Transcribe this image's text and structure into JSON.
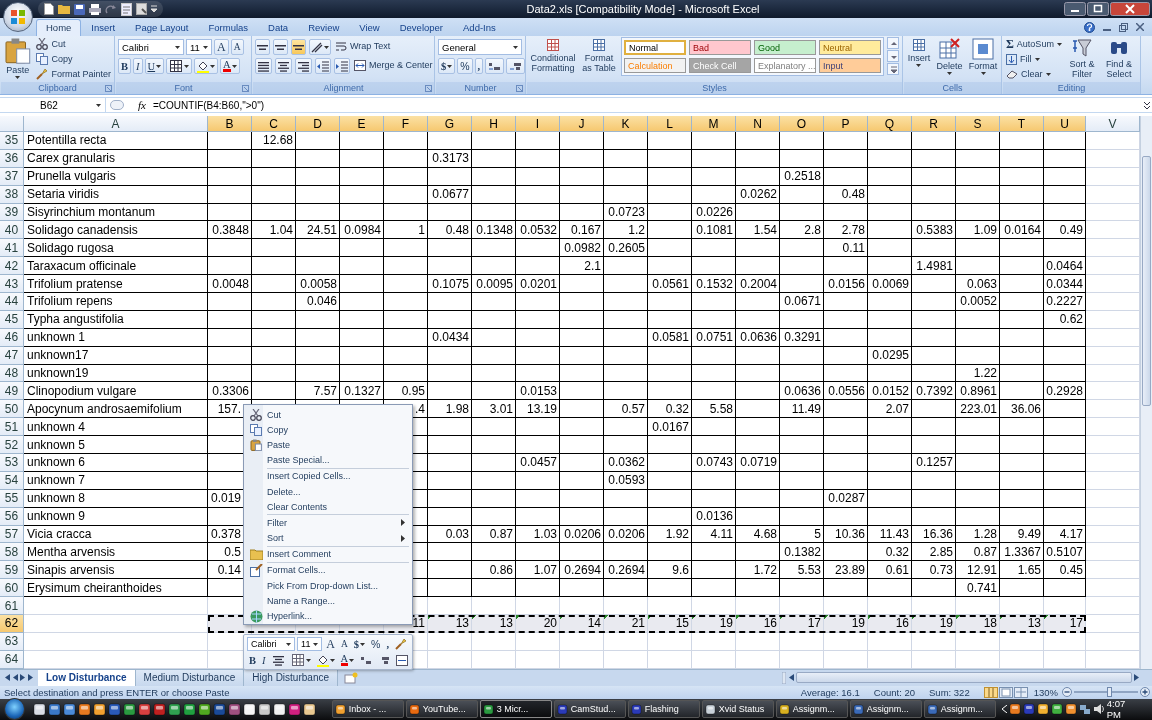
{
  "window": {
    "title": "Data2.xls  [Compatibility Mode] - Microsoft Excel"
  },
  "ribbon_tabs": [
    {
      "label": "Home",
      "selected": true
    },
    {
      "label": "Insert",
      "selected": false
    },
    {
      "label": "Page Layout",
      "selected": false
    },
    {
      "label": "Formulas",
      "selected": false
    },
    {
      "label": "Data",
      "selected": false
    },
    {
      "label": "Review",
      "selected": false
    },
    {
      "label": "View",
      "selected": false
    },
    {
      "label": "Developer",
      "selected": false
    },
    {
      "label": "Add-Ins",
      "selected": false
    }
  ],
  "ribbon": {
    "clipboard": {
      "label": "Clipboard",
      "paste": "Paste",
      "items": [
        "Cut",
        "Copy",
        "Format Painter"
      ]
    },
    "font": {
      "label": "Font",
      "name": "Calibri",
      "size": "11",
      "grow": "A",
      "shrink": "A",
      "bold": "B",
      "italic": "I",
      "underline": "U",
      "color_letter": "A"
    },
    "alignment": {
      "label": "Alignment",
      "wrap": "Wrap Text",
      "merge": "Merge & Center"
    },
    "number": {
      "label": "Number",
      "format": "General",
      "currency": "$",
      "percent": "%",
      "comma": ","
    },
    "styles": {
      "label": "Styles",
      "conditional": "Conditional Formatting",
      "table": "Format as Table",
      "gallery": [
        {
          "label": "Normal",
          "color": "#ffffff",
          "selected": true
        },
        {
          "label": "Bad",
          "color": "#ffc7ce",
          "selected": false
        },
        {
          "label": "Good",
          "color": "#c6efce",
          "selected": false
        },
        {
          "label": "Neutral",
          "color": "#ffeb9c",
          "selected": false
        },
        {
          "label": "Calculation",
          "color": "#f2f2f2",
          "selected": false
        },
        {
          "label": "Check Cell",
          "color": "#a5a5a5",
          "selected": false
        },
        {
          "label": "Explanatory ...",
          "color": "#ffffff",
          "selected": false
        },
        {
          "label": "Input",
          "color": "#ffcc99",
          "selected": false
        }
      ]
    },
    "cells": {
      "label": "Cells",
      "buttons": [
        "Insert",
        "Delete",
        "Format"
      ]
    },
    "editing": {
      "label": "Editing",
      "sigma": "Σ",
      "autosum": "AutoSum",
      "fill": "Fill",
      "clear": "Clear",
      "sort": "Sort & Filter",
      "find": "Find & Select"
    }
  },
  "formula_bar": {
    "name_box": "B62",
    "fx": "fx",
    "formula": "=COUNTIF(B4:B60,\">0\")"
  },
  "columns": [
    {
      "label": "A",
      "selected": false
    },
    {
      "label": "B",
      "selected": true
    },
    {
      "label": "C",
      "selected": true
    },
    {
      "label": "D",
      "selected": true
    },
    {
      "label": "E",
      "selected": true
    },
    {
      "label": "F",
      "selected": true
    },
    {
      "label": "G",
      "selected": true
    },
    {
      "label": "H",
      "selected": true
    },
    {
      "label": "I",
      "selected": true
    },
    {
      "label": "J",
      "selected": true
    },
    {
      "label": "K",
      "selected": true
    },
    {
      "label": "L",
      "selected": true
    },
    {
      "label": "M",
      "selected": true
    },
    {
      "label": "N",
      "selected": true
    },
    {
      "label": "O",
      "selected": true
    },
    {
      "label": "P",
      "selected": true
    },
    {
      "label": "Q",
      "selected": true
    },
    {
      "label": "R",
      "selected": true
    },
    {
      "label": "S",
      "selected": true
    },
    {
      "label": "T",
      "selected": true
    },
    {
      "label": "U",
      "selected": true
    },
    {
      "label": "V",
      "selected": false
    }
  ],
  "rows": [
    {
      "header": "35",
      "selected": false,
      "bordered": true,
      "cells": [
        "Potentilla recta",
        null,
        "12.68"
      ]
    },
    {
      "header": "36",
      "selected": false,
      "bordered": true,
      "cells": [
        "Carex granularis",
        null,
        null,
        null,
        null,
        null,
        "0.3173"
      ]
    },
    {
      "header": "37",
      "selected": false,
      "bordered": true,
      "cells": [
        "Prunella vulgaris",
        null,
        null,
        null,
        null,
        null,
        null,
        null,
        null,
        null,
        null,
        null,
        null,
        null,
        "0.2518"
      ]
    },
    {
      "header": "38",
      "selected": false,
      "bordered": true,
      "cells": [
        "Setaria viridis",
        null,
        null,
        null,
        null,
        null,
        "0.0677",
        null,
        null,
        null,
        null,
        null,
        null,
        "0.0262",
        null,
        "0.48"
      ]
    },
    {
      "header": "39",
      "selected": false,
      "bordered": true,
      "cells": [
        "Sisyrinchium montanum",
        null,
        null,
        null,
        null,
        null,
        null,
        null,
        null,
        null,
        "0.0723",
        null,
        "0.0226"
      ]
    },
    {
      "header": "40",
      "selected": false,
      "bordered": true,
      "cells": [
        "Solidago canadensis",
        "0.3848",
        "1.04",
        "24.51",
        "0.0984",
        "1",
        "0.48",
        "0.1348",
        "0.0532",
        "0.167",
        "1.2",
        null,
        "0.1081",
        "1.54",
        "2.8",
        "2.78",
        null,
        "0.5383",
        "1.09",
        "0.0164",
        "0.49"
      ]
    },
    {
      "header": "41",
      "selected": false,
      "bordered": true,
      "cells": [
        "Solidago rugosa",
        null,
        null,
        null,
        null,
        null,
        null,
        null,
        null,
        "0.0982",
        "0.2605",
        null,
        null,
        null,
        null,
        "0.11"
      ]
    },
    {
      "header": "42",
      "selected": false,
      "bordered": true,
      "cells": [
        "Taraxacum officinale",
        null,
        null,
        null,
        null,
        null,
        null,
        null,
        null,
        "2.1",
        null,
        null,
        null,
        null,
        null,
        null,
        null,
        "1.4981",
        null,
        null,
        "0.0464"
      ]
    },
    {
      "header": "43",
      "selected": false,
      "bordered": true,
      "cells": [
        "Trifolium pratense",
        "0.0048",
        null,
        "0.0058",
        null,
        null,
        "0.1075",
        "0.0095",
        "0.0201",
        null,
        null,
        "0.0561",
        "0.1532",
        "0.2004",
        null,
        "0.0156",
        "0.0069",
        null,
        "0.063",
        null,
        "0.0344"
      ]
    },
    {
      "header": "44",
      "selected": false,
      "bordered": true,
      "cells": [
        "Trifolium repens",
        null,
        null,
        "0.046",
        null,
        null,
        null,
        null,
        null,
        null,
        null,
        null,
        null,
        null,
        "0.0671",
        null,
        null,
        null,
        "0.0052",
        null,
        "0.2227"
      ]
    },
    {
      "header": "45",
      "selected": false,
      "bordered": true,
      "cells": [
        "Typha angustifolia",
        null,
        null,
        null,
        null,
        null,
        null,
        null,
        null,
        null,
        null,
        null,
        null,
        null,
        null,
        null,
        null,
        null,
        null,
        null,
        "0.62"
      ]
    },
    {
      "header": "46",
      "selected": false,
      "bordered": true,
      "cells": [
        "unknown 1",
        null,
        null,
        null,
        null,
        null,
        "0.0434",
        null,
        null,
        null,
        null,
        "0.0581",
        "0.0751",
        "0.0636",
        "0.3291"
      ]
    },
    {
      "header": "47",
      "selected": false,
      "bordered": true,
      "cells": [
        "unknown17",
        null,
        null,
        null,
        null,
        null,
        null,
        null,
        null,
        null,
        null,
        null,
        null,
        null,
        null,
        null,
        "0.0295"
      ]
    },
    {
      "header": "48",
      "selected": false,
      "bordered": true,
      "cells": [
        "unknown19",
        null,
        null,
        null,
        null,
        null,
        null,
        null,
        null,
        null,
        null,
        null,
        null,
        null,
        null,
        null,
        null,
        null,
        "1.22"
      ]
    },
    {
      "header": "49",
      "selected": false,
      "bordered": true,
      "cells": [
        "Clinopodium vulgare",
        "0.3306",
        null,
        "7.57",
        "0.1327",
        "0.95",
        null,
        null,
        "0.0153",
        null,
        null,
        null,
        null,
        null,
        "0.0636",
        "0.0556",
        "0.0152",
        "0.7392",
        "0.8961",
        null,
        "0.2928"
      ]
    },
    {
      "header": "50",
      "selected": false,
      "bordered": true,
      "cells": [
        "Apocynum androsaemifolium",
        "157.",
        null,
        null,
        null,
        ".4",
        "1.98",
        "3.01",
        "13.19",
        null,
        "0.57",
        "0.32",
        "5.58",
        null,
        "11.49",
        null,
        "2.07",
        null,
        "223.01",
        "36.06"
      ]
    },
    {
      "header": "51",
      "selected": false,
      "bordered": true,
      "cells": [
        "unknown 4",
        null,
        null,
        null,
        null,
        null,
        null,
        null,
        null,
        null,
        null,
        "0.0167"
      ]
    },
    {
      "header": "52",
      "selected": false,
      "bordered": true,
      "cells": [
        "unknown 5"
      ]
    },
    {
      "header": "53",
      "selected": false,
      "bordered": true,
      "cells": [
        "unknown 6",
        null,
        null,
        null,
        null,
        null,
        null,
        null,
        "0.0457",
        null,
        "0.0362",
        null,
        "0.0743",
        "0.0719",
        null,
        null,
        null,
        "0.1257"
      ]
    },
    {
      "header": "54",
      "selected": false,
      "bordered": true,
      "cells": [
        "unknown 7",
        null,
        null,
        null,
        null,
        null,
        null,
        null,
        null,
        null,
        "0.0593"
      ]
    },
    {
      "header": "55",
      "selected": false,
      "bordered": true,
      "cells": [
        "unknown 8",
        "0.019",
        null,
        null,
        null,
        null,
        null,
        null,
        null,
        null,
        null,
        null,
        null,
        null,
        null,
        "0.0287"
      ]
    },
    {
      "header": "56",
      "selected": false,
      "bordered": true,
      "cells": [
        "unknown 9",
        null,
        null,
        null,
        null,
        null,
        null,
        null,
        null,
        null,
        null,
        null,
        "0.0136"
      ]
    },
    {
      "header": "57",
      "selected": false,
      "bordered": true,
      "cells": [
        "Vicia cracca",
        "0.378",
        null,
        null,
        null,
        null,
        "0.03",
        "0.87",
        "1.03",
        "0.0206",
        "0.0206",
        "1.92",
        "4.11",
        "4.68",
        "5",
        "10.36",
        "11.43",
        "16.36",
        "1.28",
        "9.49",
        "4.17"
      ]
    },
    {
      "header": "58",
      "selected": false,
      "bordered": true,
      "cells": [
        "Mentha arvensis",
        "0.5",
        null,
        null,
        null,
        null,
        null,
        null,
        null,
        null,
        null,
        null,
        null,
        null,
        "0.1382",
        null,
        "0.32",
        "2.85",
        "0.87",
        "1.3367",
        "0.5107"
      ]
    },
    {
      "header": "59",
      "selected": false,
      "bordered": true,
      "cells": [
        "Sinapis arvensis",
        "0.14",
        null,
        null,
        null,
        null,
        null,
        "0.86",
        "1.07",
        "0.2694",
        "0.2694",
        "9.6",
        null,
        "1.72",
        "5.53",
        "23.89",
        "0.61",
        "0.73",
        "12.91",
        "1.65",
        "0.45"
      ]
    },
    {
      "header": "60",
      "selected": false,
      "bordered": true,
      "cells": [
        "Erysimum cheiranthoides",
        null,
        null,
        null,
        null,
        null,
        null,
        null,
        null,
        null,
        null,
        null,
        null,
        null,
        null,
        null,
        null,
        null,
        "0.741"
      ]
    },
    {
      "header": "61",
      "selected": false,
      "bordered": false,
      "cells": []
    },
    {
      "header": "62",
      "selected": true,
      "bordered": false,
      "error_marks": true,
      "cells": [
        null,
        null,
        null,
        null,
        null,
        "11",
        "13",
        "13",
        "20",
        "14",
        "21",
        "15",
        "19",
        "16",
        "17",
        "19",
        "16",
        "19",
        "18",
        "13",
        "17"
      ]
    },
    {
      "header": "63",
      "selected": false,
      "bordered": false,
      "cells": []
    },
    {
      "header": "64",
      "selected": false,
      "bordered": false,
      "cells": []
    }
  ],
  "context_menu": [
    {
      "label": "Cut",
      "icon": true,
      "separator_before": false,
      "submenu": false
    },
    {
      "label": "Copy",
      "icon": true,
      "separator_before": false,
      "submenu": false
    },
    {
      "label": "Paste",
      "icon": true,
      "separator_before": false,
      "submenu": false
    },
    {
      "label": "Paste Special...",
      "icon": false,
      "separator_before": false,
      "submenu": false
    },
    {
      "label": "Insert Copied Cells...",
      "icon": false,
      "separator_before": true,
      "submenu": false
    },
    {
      "label": "Delete...",
      "icon": false,
      "separator_before": false,
      "submenu": false
    },
    {
      "label": "Clear Contents",
      "icon": false,
      "separator_before": false,
      "submenu": false
    },
    {
      "label": "Filter",
      "icon": false,
      "separator_before": true,
      "submenu": true
    },
    {
      "label": "Sort",
      "icon": false,
      "separator_before": false,
      "submenu": true
    },
    {
      "label": "Insert Comment",
      "icon": true,
      "separator_before": true,
      "submenu": false
    },
    {
      "label": "Format Cells...",
      "icon": true,
      "separator_before": true,
      "submenu": false
    },
    {
      "label": "Pick From Drop-down List...",
      "icon": false,
      "separator_before": false,
      "submenu": false
    },
    {
      "label": "Name a Range...",
      "icon": false,
      "separator_before": false,
      "submenu": false
    },
    {
      "label": "Hyperlink...",
      "icon": true,
      "separator_before": false,
      "submenu": false
    }
  ],
  "mini_toolbar": {
    "font": "Calibri",
    "size": "11",
    "grow": "A",
    "shrink": "A",
    "currency": "$",
    "percent": "%",
    "comma": ",",
    "bold": "B",
    "italic": "I",
    "color_letter": "A"
  },
  "sheet_tabs": [
    {
      "label": "Low Disturbance",
      "selected": true
    },
    {
      "label": "Medium Disturbance",
      "selected": false
    },
    {
      "label": "High Disturbance",
      "selected": false
    }
  ],
  "status_bar": {
    "message": "Select destination and press ENTER or choose Paste",
    "average": "Average: 16.1",
    "count": "Count: 20",
    "sum": "Sum: 322",
    "zoom": "130%",
    "zoom_slider": {
      "level": 0.55
    }
  },
  "taskbar": {
    "tasks": [
      {
        "label": "Inbox - ...",
        "selected": false
      },
      {
        "label": "YouTube...",
        "selected": false
      },
      {
        "label": "3 Micr...",
        "selected": true
      },
      {
        "label": "CamStud...",
        "selected": false
      },
      {
        "label": "Flashing",
        "selected": false
      },
      {
        "label": "Xvid Status",
        "selected": false
      },
      {
        "label": "Assignm...",
        "selected": false
      },
      {
        "label": "Assignm...",
        "selected": false
      },
      {
        "label": "Assignm...",
        "selected": false
      }
    ],
    "clock": "4:07 PM"
  }
}
